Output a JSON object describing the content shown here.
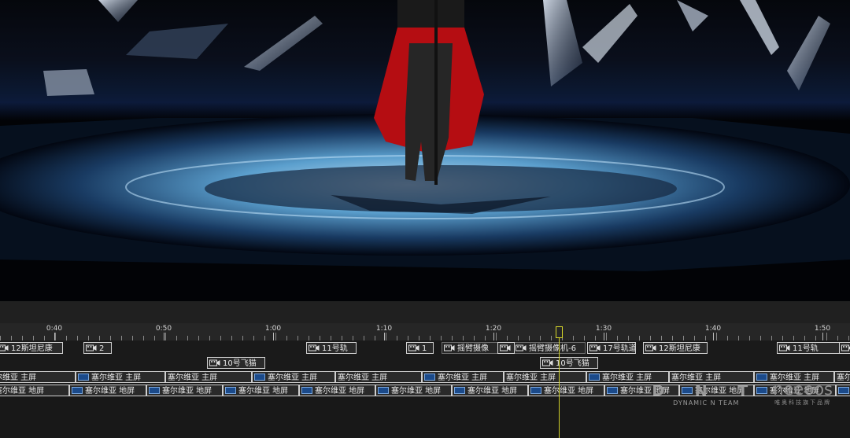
{
  "timeline": {
    "ruler_labels": [
      "0:40",
      "0:50",
      "1:00",
      "1:10",
      "1:20",
      "1:30",
      "1:40",
      "1:50"
    ],
    "camera_track": [
      {
        "label": "12斯坦尼康"
      },
      {
        "label": "2"
      },
      {
        "label": "11号轨"
      },
      {
        "label": "1"
      },
      {
        "label": "摇臂摄像"
      },
      {
        "label": "摇臂摄像机-6"
      },
      {
        "label": "17号轨道"
      },
      {
        "label": "12斯坦尼康"
      },
      {
        "label": "11号轨"
      }
    ],
    "flycam_track": [
      {
        "label": "10号飞猫"
      },
      {
        "label": "10号飞猫"
      }
    ],
    "main_screen_label": "塞尔维亚 主屏",
    "floor_screen_label": "塞尔维亚 地屏"
  },
  "watermark": {
    "brand": "D N T",
    "subtitle": "DYNAMIC N TEAM",
    "brand2": "neeoos",
    "subtitle2": "唯奥科技旗下品牌"
  }
}
